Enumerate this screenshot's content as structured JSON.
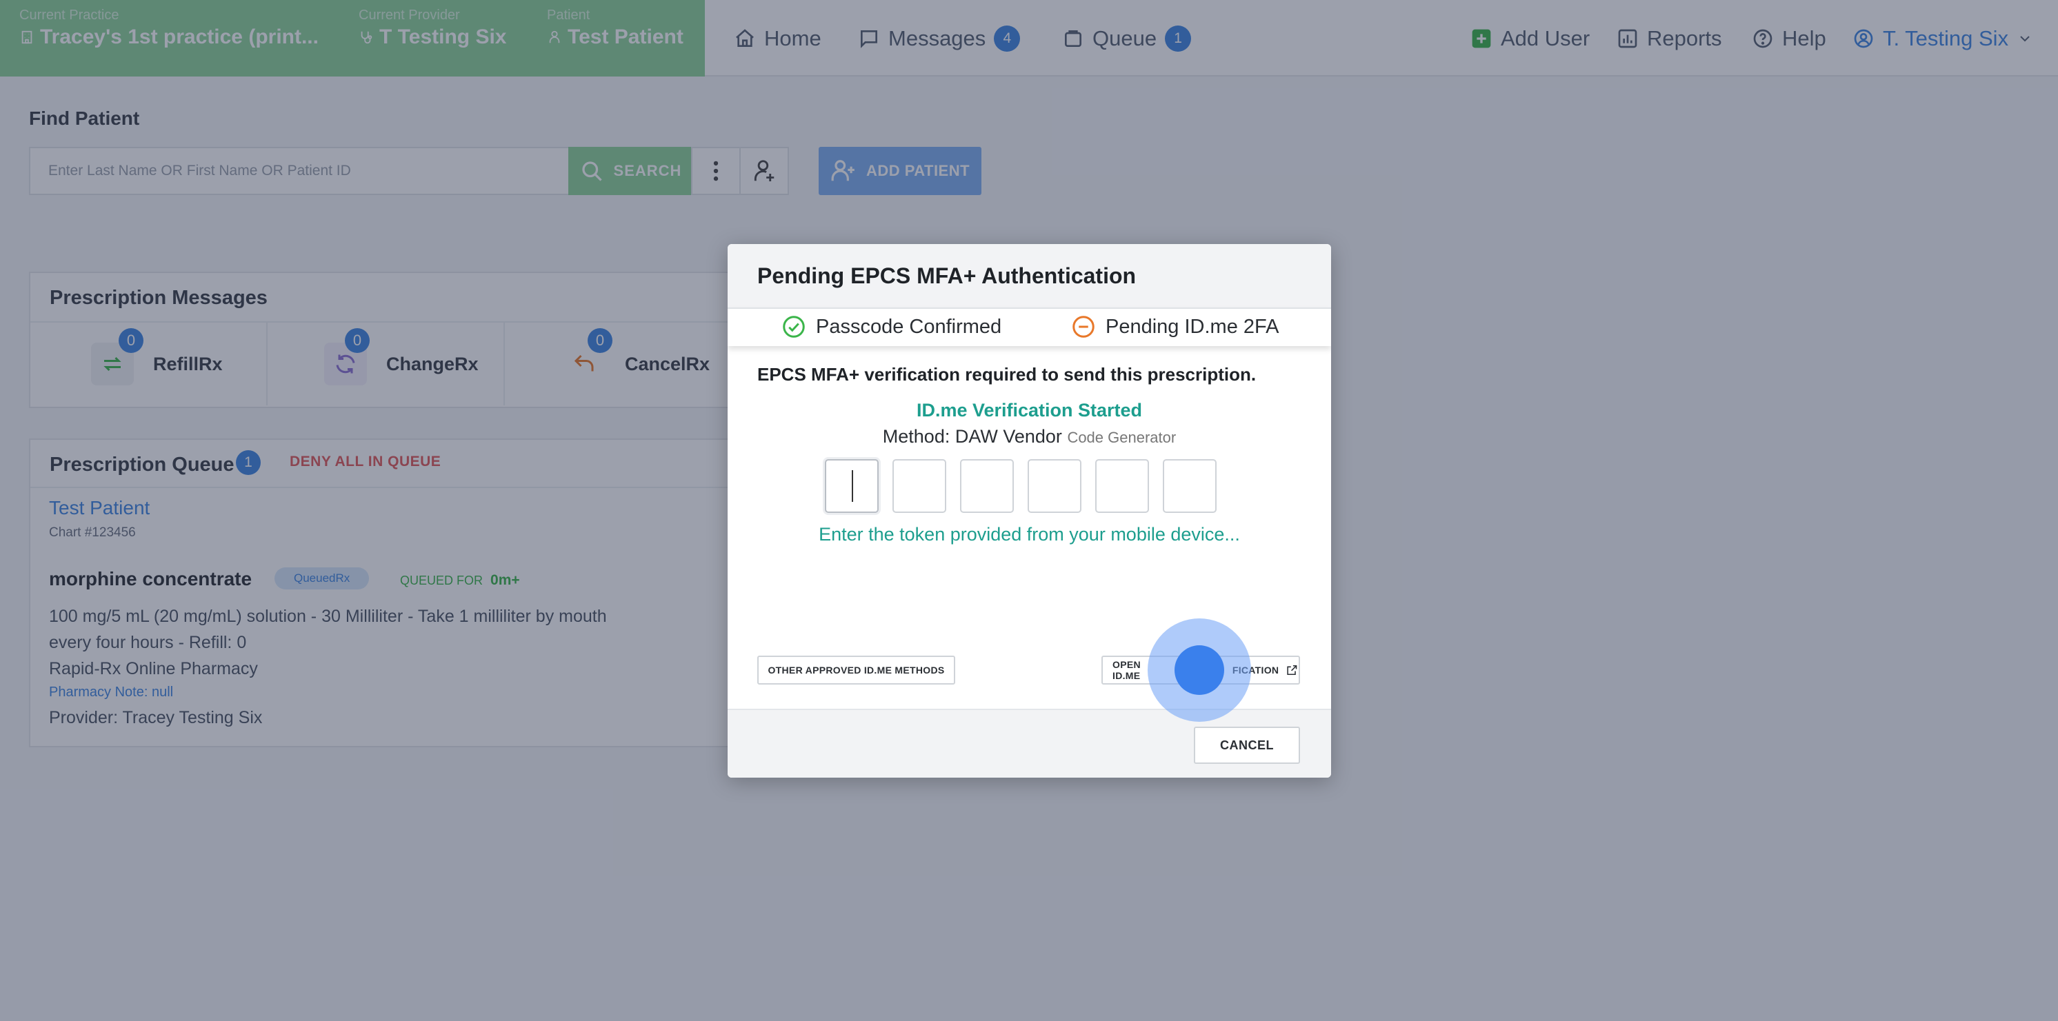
{
  "colors": {
    "context_green": "#8fd39a",
    "accent_blue": "#3f86e0",
    "teal_text": "#1d9e8e",
    "confirmed_green": "#3bb54a",
    "pending_orange": "#e8782a"
  },
  "context": {
    "practice_label": "Current Practice",
    "practice_value": "Tracey's 1st practice (print...",
    "provider_label": "Current Provider",
    "provider_value": "T Testing Six",
    "patient_label": "Patient",
    "patient_value": "Test Patient"
  },
  "nav": {
    "home": "Home",
    "messages": "Messages",
    "messages_count": "4",
    "queue": "Queue",
    "queue_count": "1",
    "add_user": "Add User",
    "reports": "Reports",
    "help": "Help",
    "user": "T. Testing Six"
  },
  "find_patient": {
    "title": "Find Patient",
    "placeholder": "Enter Last Name OR First Name OR Patient ID",
    "search_label": "SEARCH",
    "add_patient_label": "ADD PATIENT"
  },
  "prescription_messages": {
    "title": "Prescription Messages",
    "types": [
      {
        "label": "RefillRx",
        "count": "0"
      },
      {
        "label": "ChangeRx",
        "count": "0"
      },
      {
        "label": "CancelRx",
        "count": "0"
      }
    ]
  },
  "prescription_queue": {
    "title": "Prescription Queue",
    "count": "1",
    "deny_all": "DENY ALL IN QUEUE",
    "patient_name": "Test Patient",
    "chart": "Chart #123456",
    "drug": "morphine concentrate",
    "status_badge": "QueuedRx",
    "queued_for_label": "QUEUED FOR",
    "queued_for_value": "0m+",
    "sig_line1": "100 mg/5 mL (20 mg/mL) solution - 30 Milliliter - Take 1 milliliter by mouth",
    "sig_line2": "every four hours - Refill: 0",
    "pharmacy": "Rapid-Rx Online Pharmacy",
    "pharmacy_note": "Pharmacy Note: null",
    "provider": "Provider: Tracey Testing Six"
  },
  "modal": {
    "title": "Pending EPCS MFA+ Authentication",
    "status_confirmed": "Passcode Confirmed",
    "status_pending": "Pending ID.me 2FA",
    "message": "EPCS MFA+ verification required to send this prescription.",
    "verification_started": "ID.me Verification Started",
    "method_label": "Method: DAW Vendor",
    "method_sub": "Code Generator",
    "token_hint": "Enter the token provided from your mobile device...",
    "other_methods": "OTHER APPROVED ID.ME METHODS",
    "open_idme_prefix": "OPEN ID.ME",
    "open_idme_suffix": "FICATION",
    "cancel": "CANCEL"
  }
}
